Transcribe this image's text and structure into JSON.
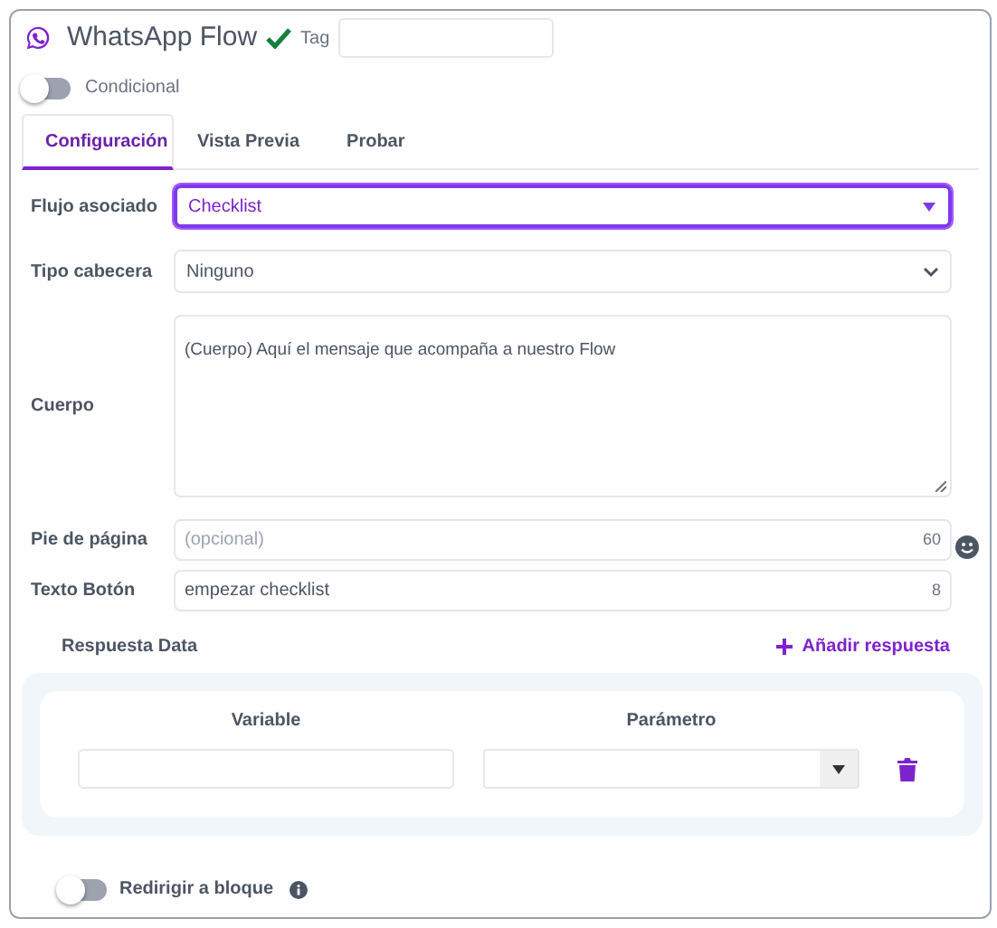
{
  "header": {
    "title": "WhatsApp Flow",
    "tag_label": "Tag"
  },
  "conditional_toggle": {
    "label": "Condicional",
    "on": false
  },
  "tabs": [
    {
      "label": "Configuración",
      "selected": true
    },
    {
      "label": "Vista Previa",
      "selected": false
    },
    {
      "label": "Probar",
      "selected": false
    }
  ],
  "fields": [
    {
      "kind": "combo",
      "label": "Flujo asociado",
      "value": "Checklist",
      "focused": true
    },
    {
      "kind": "select",
      "label": "Tipo cabecera",
      "value": "Ninguno",
      "focused": false
    },
    {
      "kind": "textarea",
      "label": "Cuerpo",
      "value": "(Cuerpo) Aquí el mensaje que acompaña a nuestro Flow",
      "focused": false
    },
    {
      "kind": "text",
      "label": "Pie de página",
      "placeholder": "(opcional)",
      "counter": "60",
      "emoji": true,
      "focused": false
    },
    {
      "kind": "text",
      "label": "Texto Botón",
      "value": "empezar checklist",
      "counter": "8",
      "emoji": false,
      "focused": false
    }
  ],
  "response_data": {
    "title": "Respuesta Data",
    "add_button": "Añadir respuesta",
    "columns": [
      "Variable",
      "Parámetro"
    ],
    "rows": [
      {
        "kind": "pair"
      }
    ]
  },
  "redirect_toggle": {
    "label": "Redirigir a bloque",
    "on": false
  }
}
